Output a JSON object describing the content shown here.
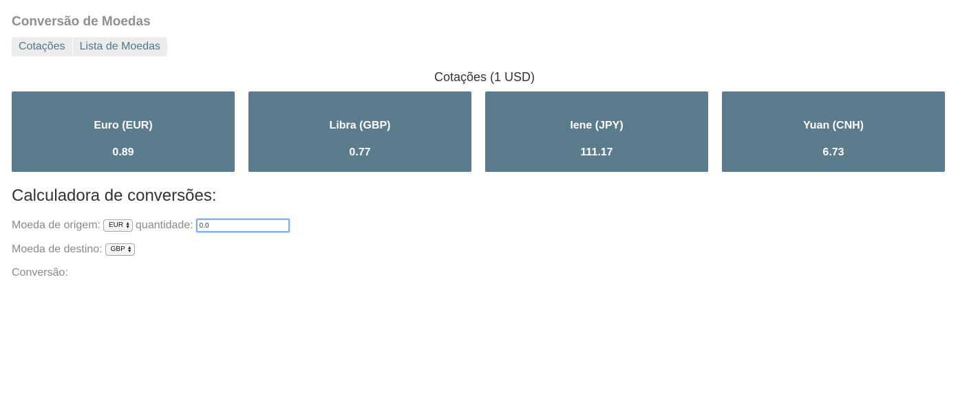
{
  "app": {
    "title": "Conversão de Moedas"
  },
  "nav": {
    "tabs": [
      {
        "label": "Cotações"
      },
      {
        "label": "Lista de Moedas"
      }
    ]
  },
  "quotes": {
    "title": "Cotações (1 USD)",
    "cards": [
      {
        "name": "Euro (EUR)",
        "value": "0.89"
      },
      {
        "name": "Libra (GBP)",
        "value": "0.77"
      },
      {
        "name": "Iene (JPY)",
        "value": "111.17"
      },
      {
        "name": "Yuan (CNH)",
        "value": "6.73"
      }
    ]
  },
  "calculator": {
    "title": "Calculadora de conversões:",
    "origin_label": "Moeda de origem:",
    "origin_selected": "EUR",
    "quantity_label": "quantidade:",
    "quantity_value": "0.0",
    "dest_label": "Moeda de destino:",
    "dest_selected": "GBP",
    "result_label": "Conversão:"
  },
  "colors": {
    "card_bg": "#5a7c8c",
    "tab_text": "#4a7a8c",
    "input_focus": "#7fb2ea"
  }
}
